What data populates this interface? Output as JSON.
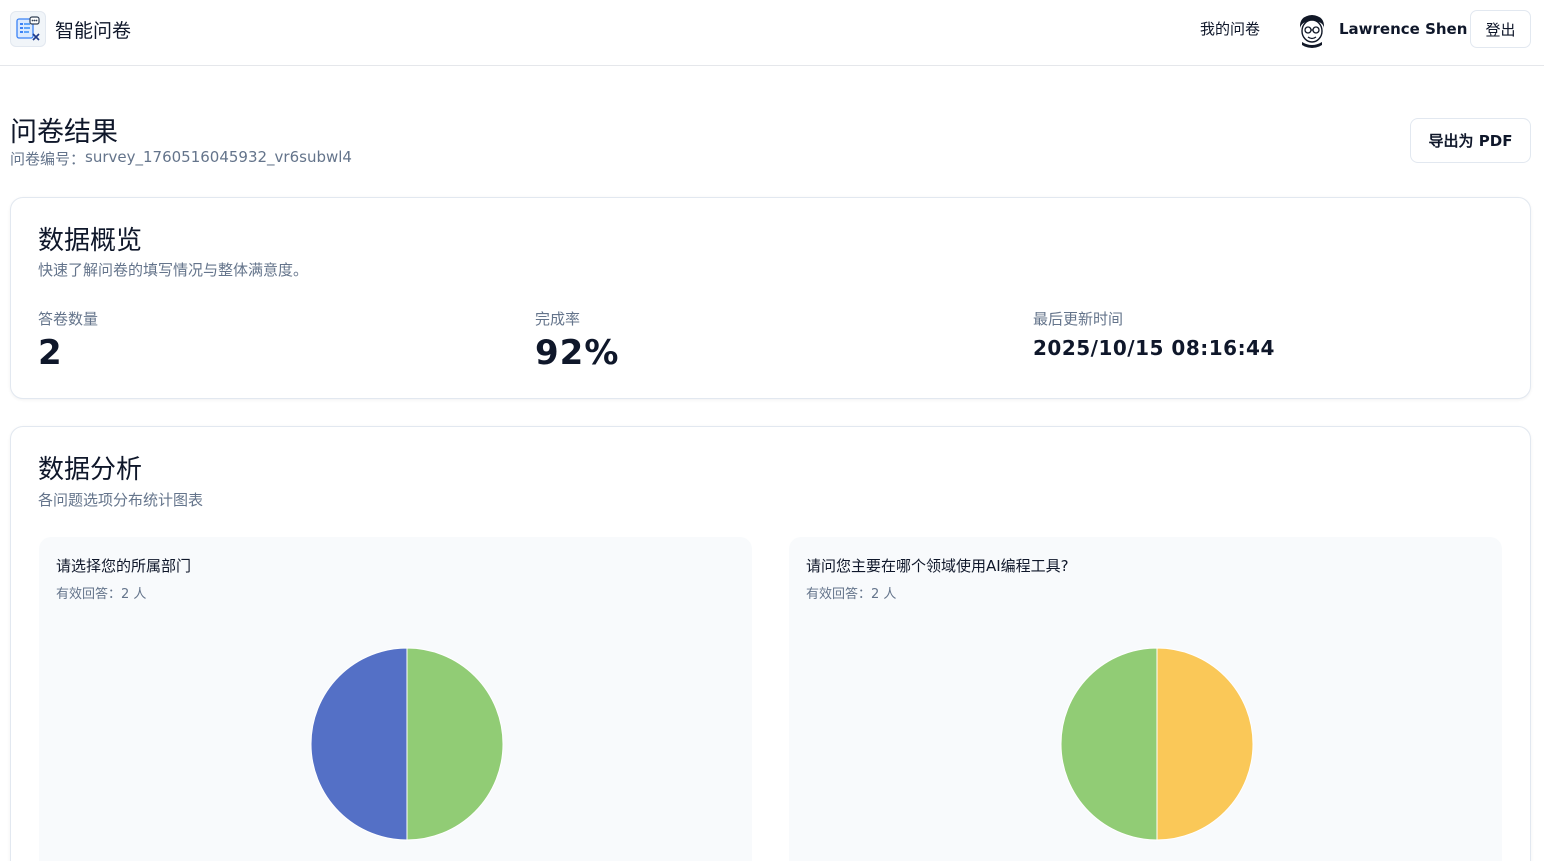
{
  "header": {
    "app_title": "智能问卷",
    "nav_my_surveys": "我的问卷",
    "user_name": "Lawrence Shen",
    "logout_label": "登出"
  },
  "page": {
    "title": "问卷结果",
    "survey_id_label": "问卷编号：",
    "survey_id": "survey_1760516045932_vr6subwl4",
    "export_label": "导出为 PDF"
  },
  "overview": {
    "title": "数据概览",
    "description": "快速了解问卷的填写情况与整体满意度。",
    "stats": [
      {
        "label": "答卷数量",
        "value": "2"
      },
      {
        "label": "完成率",
        "value": "92%"
      },
      {
        "label": "最后更新时间",
        "value": "2025/10/15 08:16:44"
      }
    ]
  },
  "analysis": {
    "title": "数据分析",
    "description": "各问题选项分布统计图表",
    "questions": [
      {
        "title": "请选择您的所属部门",
        "responses_label": "有效回答：",
        "responses_value": "2 人"
      },
      {
        "title": "请问您主要在哪个领域使用AI编程工具?",
        "responses_label": "有效回答：",
        "responses_value": "2 人"
      }
    ]
  },
  "colors": {
    "blue": "#5470c6",
    "green": "#91cc75",
    "yellow": "#fac858"
  },
  "chart_data": [
    {
      "type": "pie",
      "values": [
        1,
        1
      ],
      "colors": [
        "#91cc75",
        "#5470c6"
      ]
    },
    {
      "type": "pie",
      "values": [
        1,
        1
      ],
      "colors": [
        "#fac858",
        "#91cc75"
      ]
    }
  ]
}
